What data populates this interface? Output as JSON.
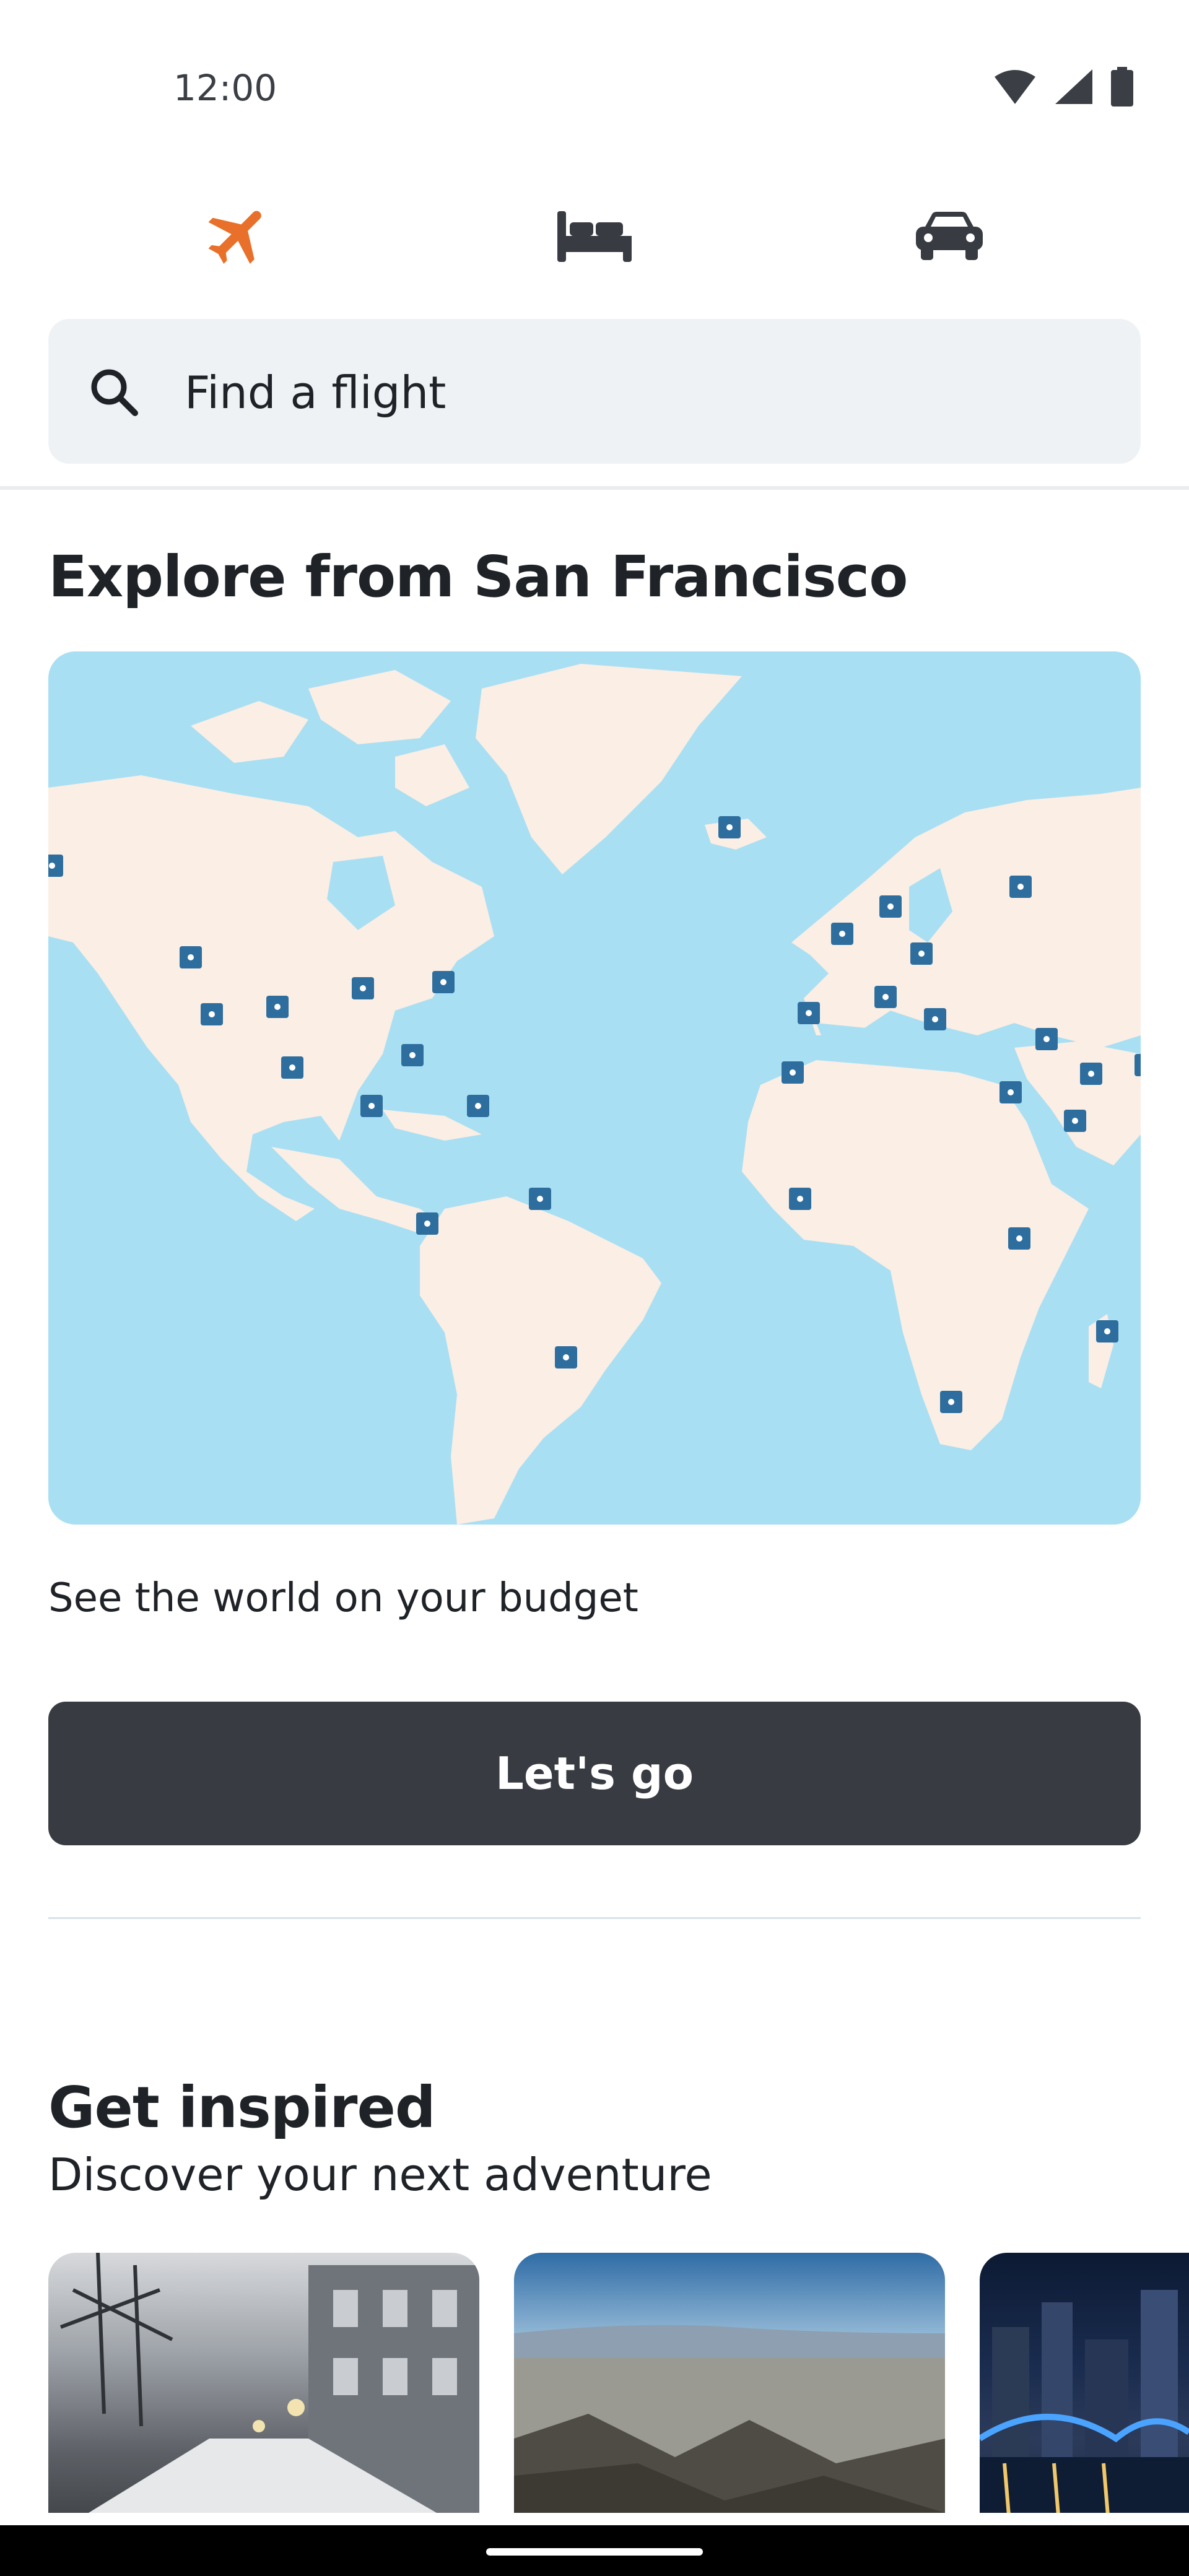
{
  "status_bar": {
    "time": "12:00"
  },
  "tabs": [
    {
      "id": "flights",
      "icon": "airplane-icon",
      "active": true
    },
    {
      "id": "hotels",
      "icon": "bed-icon",
      "active": false
    },
    {
      "id": "cars",
      "icon": "car-icon",
      "active": false
    }
  ],
  "search": {
    "placeholder": "Find a flight"
  },
  "explore": {
    "title": "Explore from San Francisco",
    "subtitle": "See the world on your budget",
    "button_label": "Let's go"
  },
  "inspired": {
    "title": "Get inspired",
    "subtitle": "Discover your next adventure",
    "cards": [
      {
        "icon": "snowy-street-photo"
      },
      {
        "icon": "mountain-valley-photo"
      },
      {
        "icon": "city-bridge-night-photo"
      }
    ]
  },
  "colors": {
    "accent": "#e8702a",
    "map_water": "#a9dff3",
    "map_land": "#fbeee4",
    "map_pin": "#2e6e9e",
    "button": "#383c42"
  }
}
